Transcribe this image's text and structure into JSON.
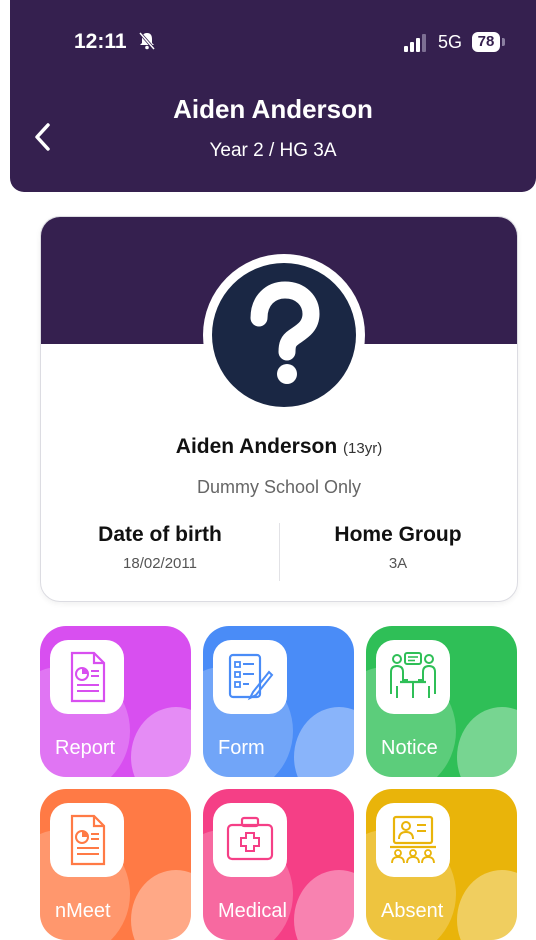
{
  "status_bar": {
    "time": "12:11",
    "network": "5G",
    "battery": "78"
  },
  "header": {
    "title": "Aiden Anderson",
    "subtitle": "Year 2 / HG 3A"
  },
  "profile": {
    "name": "Aiden Anderson",
    "age": "(13yr)",
    "school": "Dummy School Only",
    "dob_label": "Date of birth",
    "dob_value": "18/02/2011",
    "home_group_label": "Home Group",
    "home_group_value": "3A"
  },
  "tiles": [
    {
      "label": "Report",
      "icon": "report-icon",
      "color": "#d84ff0"
    },
    {
      "label": "Form",
      "icon": "form-icon",
      "color": "#4a8cf7"
    },
    {
      "label": "Notice",
      "icon": "notice-icon",
      "color": "#2fbf57"
    },
    {
      "label": "nMeet",
      "icon": "meeting-report-icon",
      "color": "#ff7a45"
    },
    {
      "label": "Medical",
      "icon": "medical-kit-icon",
      "color": "#f53f86"
    },
    {
      "label": "Absent",
      "icon": "absent-icon",
      "color": "#e9b40a"
    }
  ]
}
